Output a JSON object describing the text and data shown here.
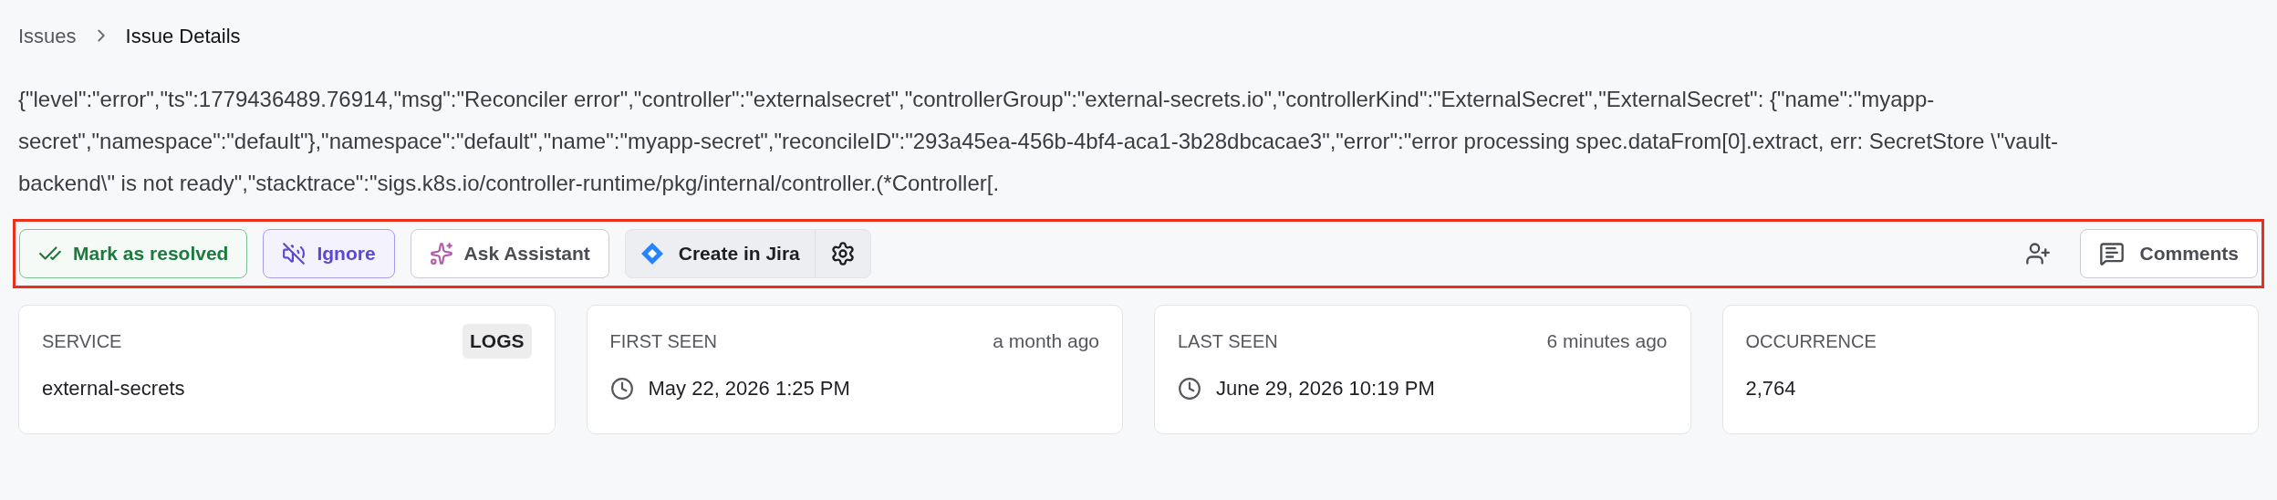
{
  "breadcrumb": [
    {
      "label": "Issues"
    },
    {
      "label": "Issue Details"
    }
  ],
  "message": "{\"level\":\"error\",\"ts\":1779436489.76914,\"msg\":\"Reconciler error\",\"controller\":\"externalsecret\",\"controllerGroup\":\"external-secrets.io\",\"controllerKind\":\"ExternalSecret\",\"ExternalSecret\": {\"name\":\"myapp-secret\",\"namespace\":\"default\"},\"namespace\":\"default\",\"name\":\"myapp-secret\",\"reconcileID\":\"293a45ea-456b-4bf4-aca1-3b28dbcacae3\",\"error\":\"error processing spec.dataFrom[0].extract, err: SecretStore \\\"vault-backend\\\" is not ready\",\"stacktrace\":\"sigs.k8s.io/controller-runtime/pkg/internal/controller.(*Controller[.",
  "toolbar": {
    "actions": [
      {
        "kind": "resolve",
        "label": "Mark as resolved"
      },
      {
        "kind": "ignore",
        "label": "Ignore"
      },
      {
        "kind": "assistant",
        "label": "Ask Assistant"
      },
      {
        "kind": "jira",
        "label": "Create in Jira"
      }
    ],
    "comments": {
      "label": "Comments"
    }
  },
  "cards": [
    {
      "kind": "badge",
      "label": "SERVICE",
      "aside": "LOGS",
      "value": "external-secrets"
    },
    {
      "kind": "time",
      "label": "FIRST SEEN",
      "aside": "a month ago",
      "value": "May 22, 2026 1:25 PM"
    },
    {
      "kind": "time",
      "label": "LAST SEEN",
      "aside": "6 minutes ago",
      "value": "June 29, 2026 10:19 PM"
    },
    {
      "kind": "plain",
      "label": "OCCURRENCE",
      "value": "2,764"
    }
  ]
}
